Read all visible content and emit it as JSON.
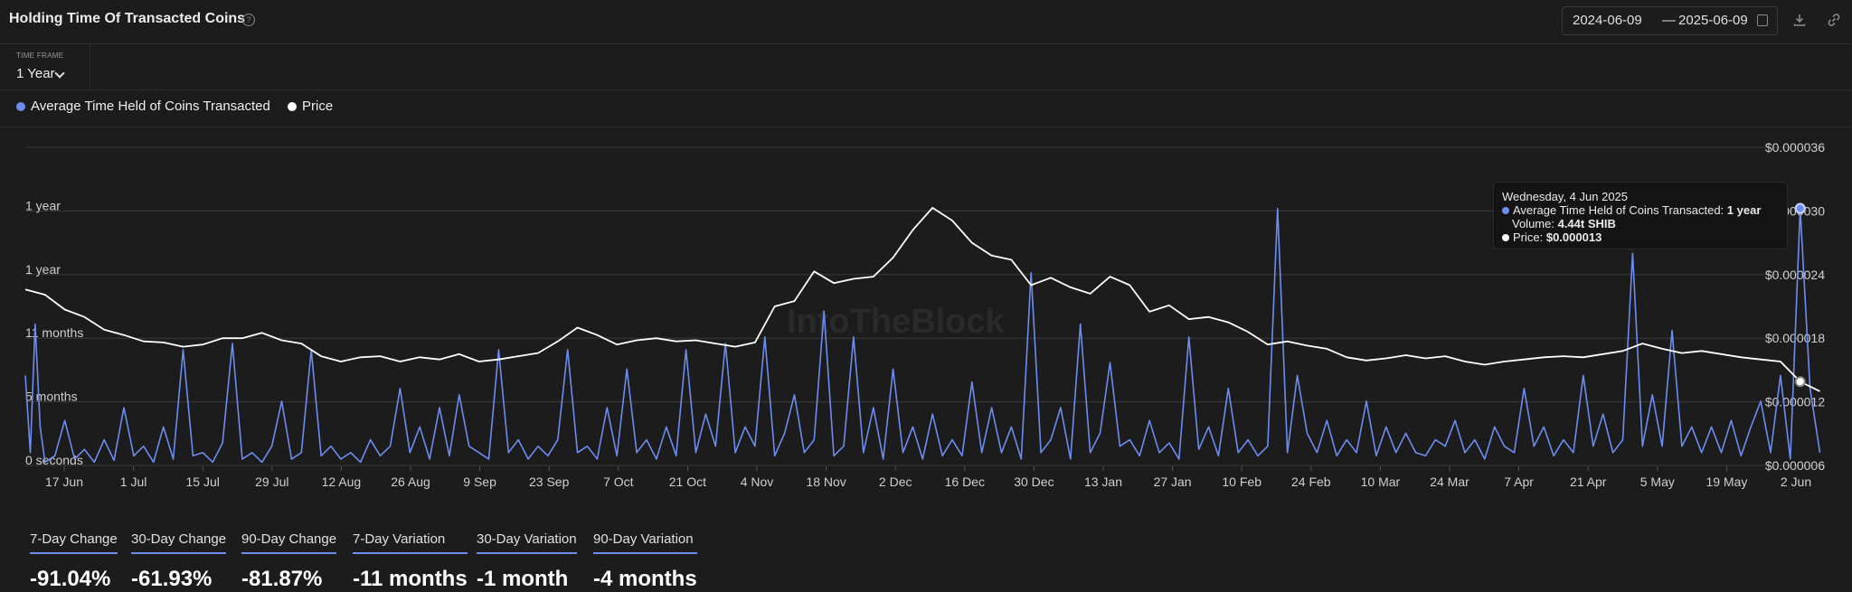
{
  "header": {
    "title": "Holding Time Of Transacted Coins",
    "date_from": "2024-06-09",
    "date_sep": "—",
    "date_to": "2025-06-09"
  },
  "timeframe": {
    "label": "TIME FRAME",
    "value": "1 Year"
  },
  "legend": [
    {
      "label": "Average Time Held of Coins Transacted",
      "color": "#6d8cf0"
    },
    {
      "label": "Price",
      "color": "#ffffff"
    }
  ],
  "watermark": "IntoTheBlock",
  "tooltip": {
    "date": "Wednesday, 4 Jun 2025",
    "line1_label": "Average Time Held of Coins Transacted: ",
    "line1_value": "1 year",
    "line2_label": "Volume: ",
    "line2_value": "4.44t SHIB",
    "line3_label": "Price: ",
    "line3_value": "$0.000013"
  },
  "metrics": [
    {
      "label": "7-Day Change",
      "value": "-91.04%"
    },
    {
      "label": "30-Day Change",
      "value": "-61.93%"
    },
    {
      "label": "90-Day Change",
      "value": "-81.87%"
    },
    {
      "label": "7-Day Variation",
      "value": "-11 months"
    },
    {
      "label": "30-Day Variation",
      "value": "-1 month"
    },
    {
      "label": "90-Day Variation",
      "value": "-4 months"
    }
  ],
  "icons": [
    "help-icon",
    "calendar-icon",
    "download-icon",
    "link-icon"
  ],
  "chart_data": {
    "type": "line",
    "x_ticks": [
      "17 Jun",
      "1 Jul",
      "15 Jul",
      "29 Jul",
      "12 Aug",
      "26 Aug",
      "9 Sep",
      "23 Sep",
      "7 Oct",
      "21 Oct",
      "4 Nov",
      "18 Nov",
      "2 Dec",
      "16 Dec",
      "30 Dec",
      "13 Jan",
      "27 Jan",
      "10 Feb",
      "24 Feb",
      "10 Mar",
      "24 Mar",
      "7 Apr",
      "21 Apr",
      "5 May",
      "19 May",
      "2 Jun"
    ],
    "left_ticks": [
      "0 seconds",
      "5 months",
      "11 months",
      "1 year",
      "1 year"
    ],
    "right_ticks": [
      "$0.000006",
      "$0.000012",
      "$0.000018",
      "$0.000024",
      "$0.000030",
      "$0.000036"
    ],
    "right_ylim": [
      6e-06,
      3.6e-05
    ],
    "x_range_days": [
      0,
      365
    ],
    "series": [
      {
        "name": "Price",
        "color": "#ffffff",
        "points": [
          [
            0,
            2.26e-05
          ],
          [
            4,
            2.21e-05
          ],
          [
            8,
            2.07e-05
          ],
          [
            12,
            2e-05
          ],
          [
            16,
            1.88e-05
          ],
          [
            20,
            1.83e-05
          ],
          [
            24,
            1.77e-05
          ],
          [
            28,
            1.76e-05
          ],
          [
            32,
            1.72e-05
          ],
          [
            36,
            1.74e-05
          ],
          [
            40,
            1.8e-05
          ],
          [
            44,
            1.8e-05
          ],
          [
            48,
            1.85e-05
          ],
          [
            52,
            1.78e-05
          ],
          [
            56,
            1.75e-05
          ],
          [
            60,
            1.63e-05
          ],
          [
            64,
            1.58e-05
          ],
          [
            68,
            1.62e-05
          ],
          [
            72,
            1.63e-05
          ],
          [
            76,
            1.58e-05
          ],
          [
            80,
            1.62e-05
          ],
          [
            84,
            1.6e-05
          ],
          [
            88,
            1.65e-05
          ],
          [
            92,
            1.58e-05
          ],
          [
            96,
            1.6e-05
          ],
          [
            100,
            1.63e-05
          ],
          [
            104,
            1.66e-05
          ],
          [
            108,
            1.77e-05
          ],
          [
            112,
            1.9e-05
          ],
          [
            116,
            1.83e-05
          ],
          [
            120,
            1.74e-05
          ],
          [
            124,
            1.78e-05
          ],
          [
            128,
            1.8e-05
          ],
          [
            132,
            1.77e-05
          ],
          [
            136,
            1.78e-05
          ],
          [
            140,
            1.75e-05
          ],
          [
            144,
            1.72e-05
          ],
          [
            148,
            1.76e-05
          ],
          [
            152,
            2.1e-05
          ],
          [
            156,
            2.15e-05
          ],
          [
            160,
            2.43e-05
          ],
          [
            164,
            2.32e-05
          ],
          [
            168,
            2.36e-05
          ],
          [
            172,
            2.38e-05
          ],
          [
            176,
            2.56e-05
          ],
          [
            180,
            2.82e-05
          ],
          [
            184,
            3.03e-05
          ],
          [
            188,
            2.91e-05
          ],
          [
            192,
            2.7e-05
          ],
          [
            196,
            2.58e-05
          ],
          [
            200,
            2.54e-05
          ],
          [
            204,
            2.3e-05
          ],
          [
            208,
            2.37e-05
          ],
          [
            212,
            2.28e-05
          ],
          [
            216,
            2.22e-05
          ],
          [
            220,
            2.38e-05
          ],
          [
            224,
            2.3e-05
          ],
          [
            228,
            2.05e-05
          ],
          [
            232,
            2.11e-05
          ],
          [
            236,
            1.98e-05
          ],
          [
            240,
            2e-05
          ],
          [
            244,
            1.95e-05
          ],
          [
            248,
            1.86e-05
          ],
          [
            252,
            1.74e-05
          ],
          [
            256,
            1.77e-05
          ],
          [
            260,
            1.73e-05
          ],
          [
            264,
            1.7e-05
          ],
          [
            268,
            1.62e-05
          ],
          [
            272,
            1.59e-05
          ],
          [
            276,
            1.61e-05
          ],
          [
            280,
            1.64e-05
          ],
          [
            284,
            1.61e-05
          ],
          [
            288,
            1.63e-05
          ],
          [
            292,
            1.58e-05
          ],
          [
            296,
            1.55e-05
          ],
          [
            300,
            1.58e-05
          ],
          [
            304,
            1.6e-05
          ],
          [
            308,
            1.62e-05
          ],
          [
            312,
            1.63e-05
          ],
          [
            316,
            1.62e-05
          ],
          [
            320,
            1.65e-05
          ],
          [
            324,
            1.68e-05
          ],
          [
            328,
            1.75e-05
          ],
          [
            332,
            1.7e-05
          ],
          [
            336,
            1.66e-05
          ],
          [
            340,
            1.68e-05
          ],
          [
            344,
            1.65e-05
          ],
          [
            348,
            1.62e-05
          ],
          [
            352,
            1.6e-05
          ],
          [
            356,
            1.58e-05
          ],
          [
            360,
            1.39e-05
          ],
          [
            364,
            1.3e-05
          ]
        ]
      },
      {
        "name": "Average Time Held of Coins Transacted",
        "color": "#6d8cf0",
        "ylim_days": [
          0,
          495
        ],
        "points": [
          [
            0,
            140
          ],
          [
            1,
            20
          ],
          [
            2,
            220
          ],
          [
            3,
            60
          ],
          [
            4,
            5
          ],
          [
            6,
            15
          ],
          [
            8,
            70
          ],
          [
            10,
            10
          ],
          [
            12,
            25
          ],
          [
            14,
            5
          ],
          [
            16,
            40
          ],
          [
            18,
            8
          ],
          [
            20,
            90
          ],
          [
            22,
            15
          ],
          [
            24,
            30
          ],
          [
            26,
            5
          ],
          [
            28,
            60
          ],
          [
            30,
            10
          ],
          [
            32,
            180
          ],
          [
            34,
            15
          ],
          [
            36,
            20
          ],
          [
            38,
            5
          ],
          [
            40,
            35
          ],
          [
            42,
            190
          ],
          [
            44,
            10
          ],
          [
            46,
            20
          ],
          [
            48,
            5
          ],
          [
            50,
            30
          ],
          [
            52,
            100
          ],
          [
            54,
            10
          ],
          [
            56,
            20
          ],
          [
            58,
            180
          ],
          [
            60,
            15
          ],
          [
            62,
            30
          ],
          [
            64,
            10
          ],
          [
            66,
            20
          ],
          [
            68,
            5
          ],
          [
            70,
            40
          ],
          [
            72,
            15
          ],
          [
            74,
            30
          ],
          [
            76,
            120
          ],
          [
            78,
            20
          ],
          [
            80,
            60
          ],
          [
            82,
            10
          ],
          [
            84,
            90
          ],
          [
            86,
            15
          ],
          [
            88,
            110
          ],
          [
            90,
            30
          ],
          [
            92,
            20
          ],
          [
            94,
            10
          ],
          [
            96,
            180
          ],
          [
            98,
            20
          ],
          [
            100,
            40
          ],
          [
            102,
            10
          ],
          [
            104,
            30
          ],
          [
            106,
            15
          ],
          [
            108,
            40
          ],
          [
            110,
            180
          ],
          [
            112,
            20
          ],
          [
            114,
            30
          ],
          [
            116,
            10
          ],
          [
            118,
            90
          ],
          [
            120,
            15
          ],
          [
            122,
            150
          ],
          [
            124,
            20
          ],
          [
            126,
            40
          ],
          [
            128,
            10
          ],
          [
            130,
            60
          ],
          [
            132,
            15
          ],
          [
            134,
            180
          ],
          [
            136,
            20
          ],
          [
            138,
            80
          ],
          [
            140,
            30
          ],
          [
            142,
            190
          ],
          [
            144,
            20
          ],
          [
            146,
            60
          ],
          [
            148,
            30
          ],
          [
            150,
            200
          ],
          [
            152,
            15
          ],
          [
            154,
            50
          ],
          [
            156,
            110
          ],
          [
            158,
            20
          ],
          [
            160,
            40
          ],
          [
            162,
            240
          ],
          [
            164,
            15
          ],
          [
            166,
            30
          ],
          [
            168,
            200
          ],
          [
            170,
            20
          ],
          [
            172,
            90
          ],
          [
            174,
            10
          ],
          [
            176,
            150
          ],
          [
            178,
            20
          ],
          [
            180,
            60
          ],
          [
            182,
            10
          ],
          [
            184,
            80
          ],
          [
            186,
            15
          ],
          [
            188,
            40
          ],
          [
            190,
            15
          ],
          [
            192,
            130
          ],
          [
            194,
            20
          ],
          [
            196,
            90
          ],
          [
            198,
            20
          ],
          [
            200,
            60
          ],
          [
            202,
            10
          ],
          [
            204,
            300
          ],
          [
            206,
            20
          ],
          [
            208,
            40
          ],
          [
            210,
            90
          ],
          [
            212,
            10
          ],
          [
            214,
            220
          ],
          [
            216,
            20
          ],
          [
            218,
            50
          ],
          [
            220,
            160
          ],
          [
            222,
            30
          ],
          [
            224,
            40
          ],
          [
            226,
            15
          ],
          [
            228,
            70
          ],
          [
            230,
            20
          ],
          [
            232,
            35
          ],
          [
            234,
            10
          ],
          [
            236,
            200
          ],
          [
            238,
            25
          ],
          [
            240,
            60
          ],
          [
            242,
            15
          ],
          [
            244,
            120
          ],
          [
            246,
            20
          ],
          [
            248,
            40
          ],
          [
            250,
            15
          ],
          [
            252,
            30
          ],
          [
            254,
            400
          ],
          [
            256,
            20
          ],
          [
            258,
            140
          ],
          [
            260,
            50
          ],
          [
            262,
            20
          ],
          [
            264,
            70
          ],
          [
            266,
            15
          ],
          [
            268,
            40
          ],
          [
            270,
            20
          ],
          [
            272,
            100
          ],
          [
            274,
            15
          ],
          [
            276,
            60
          ],
          [
            278,
            20
          ],
          [
            280,
            50
          ],
          [
            282,
            20
          ],
          [
            284,
            15
          ],
          [
            286,
            40
          ],
          [
            288,
            30
          ],
          [
            290,
            70
          ],
          [
            292,
            20
          ],
          [
            294,
            40
          ],
          [
            296,
            10
          ],
          [
            298,
            60
          ],
          [
            300,
            30
          ],
          [
            302,
            20
          ],
          [
            304,
            120
          ],
          [
            306,
            30
          ],
          [
            308,
            60
          ],
          [
            310,
            15
          ],
          [
            312,
            40
          ],
          [
            314,
            20
          ],
          [
            316,
            140
          ],
          [
            318,
            30
          ],
          [
            320,
            80
          ],
          [
            322,
            20
          ],
          [
            324,
            40
          ],
          [
            326,
            330
          ],
          [
            328,
            30
          ],
          [
            330,
            110
          ],
          [
            332,
            30
          ],
          [
            334,
            210
          ],
          [
            336,
            30
          ],
          [
            338,
            60
          ],
          [
            340,
            20
          ],
          [
            342,
            60
          ],
          [
            344,
            20
          ],
          [
            346,
            70
          ],
          [
            348,
            15
          ],
          [
            350,
            60
          ],
          [
            352,
            100
          ],
          [
            354,
            20
          ],
          [
            356,
            140
          ],
          [
            358,
            10
          ],
          [
            360,
            400
          ],
          [
            362,
            120
          ],
          [
            364,
            20
          ]
        ]
      }
    ]
  }
}
